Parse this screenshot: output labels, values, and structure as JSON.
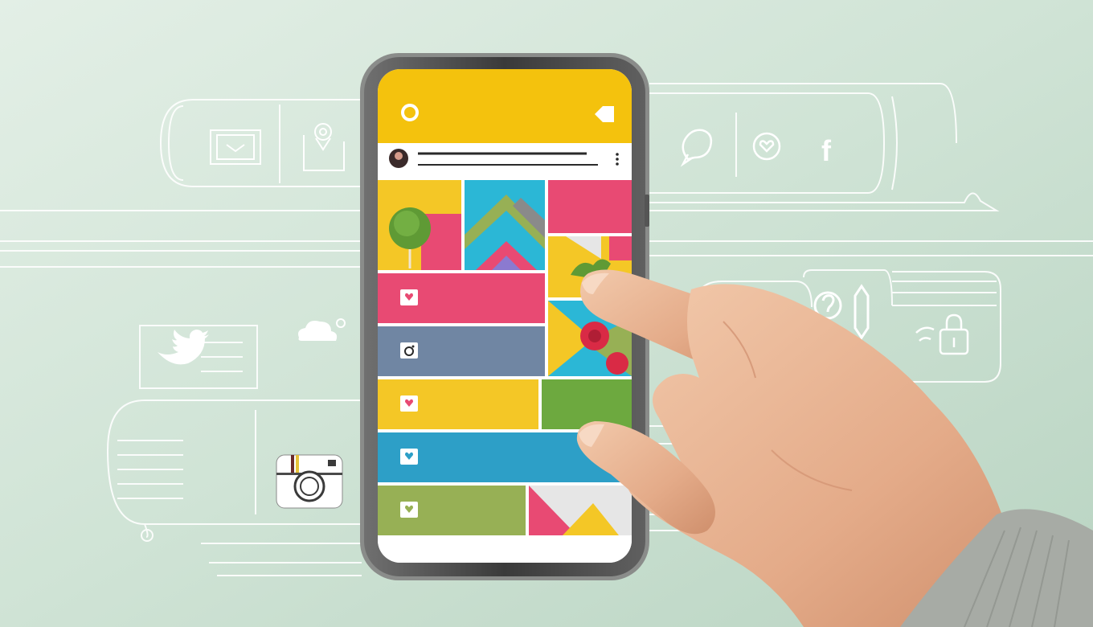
{
  "scene": {
    "description_colors": {
      "wall": "#c9e0d1",
      "line_art": "#ffffff",
      "phone_frame": "#4a4a4a",
      "header_yellow": "#f4c20d",
      "tile_pink": "#e84a73",
      "tile_slate": "#7086a3",
      "tile_yellow": "#f4c726",
      "tile_blue": "#2d9fc7",
      "tile_green": "#97b055",
      "skin": "#e8b391",
      "sleeve": "#a7aba5"
    },
    "icons": [
      "image-frame-icon",
      "map-pin-card-icon",
      "chat-bubble-icon",
      "heart-circle-icon",
      "facebook-f-icon",
      "twitter-bird-icon",
      "cloud-icon",
      "camera-icon",
      "lock-icon",
      "question-icon",
      "pencil-icon"
    ],
    "phone_icons": [
      "status-circle-icon",
      "tag-icon",
      "avatar",
      "kebab-menu-icon",
      "heart-icon",
      "instagram-icon"
    ]
  }
}
